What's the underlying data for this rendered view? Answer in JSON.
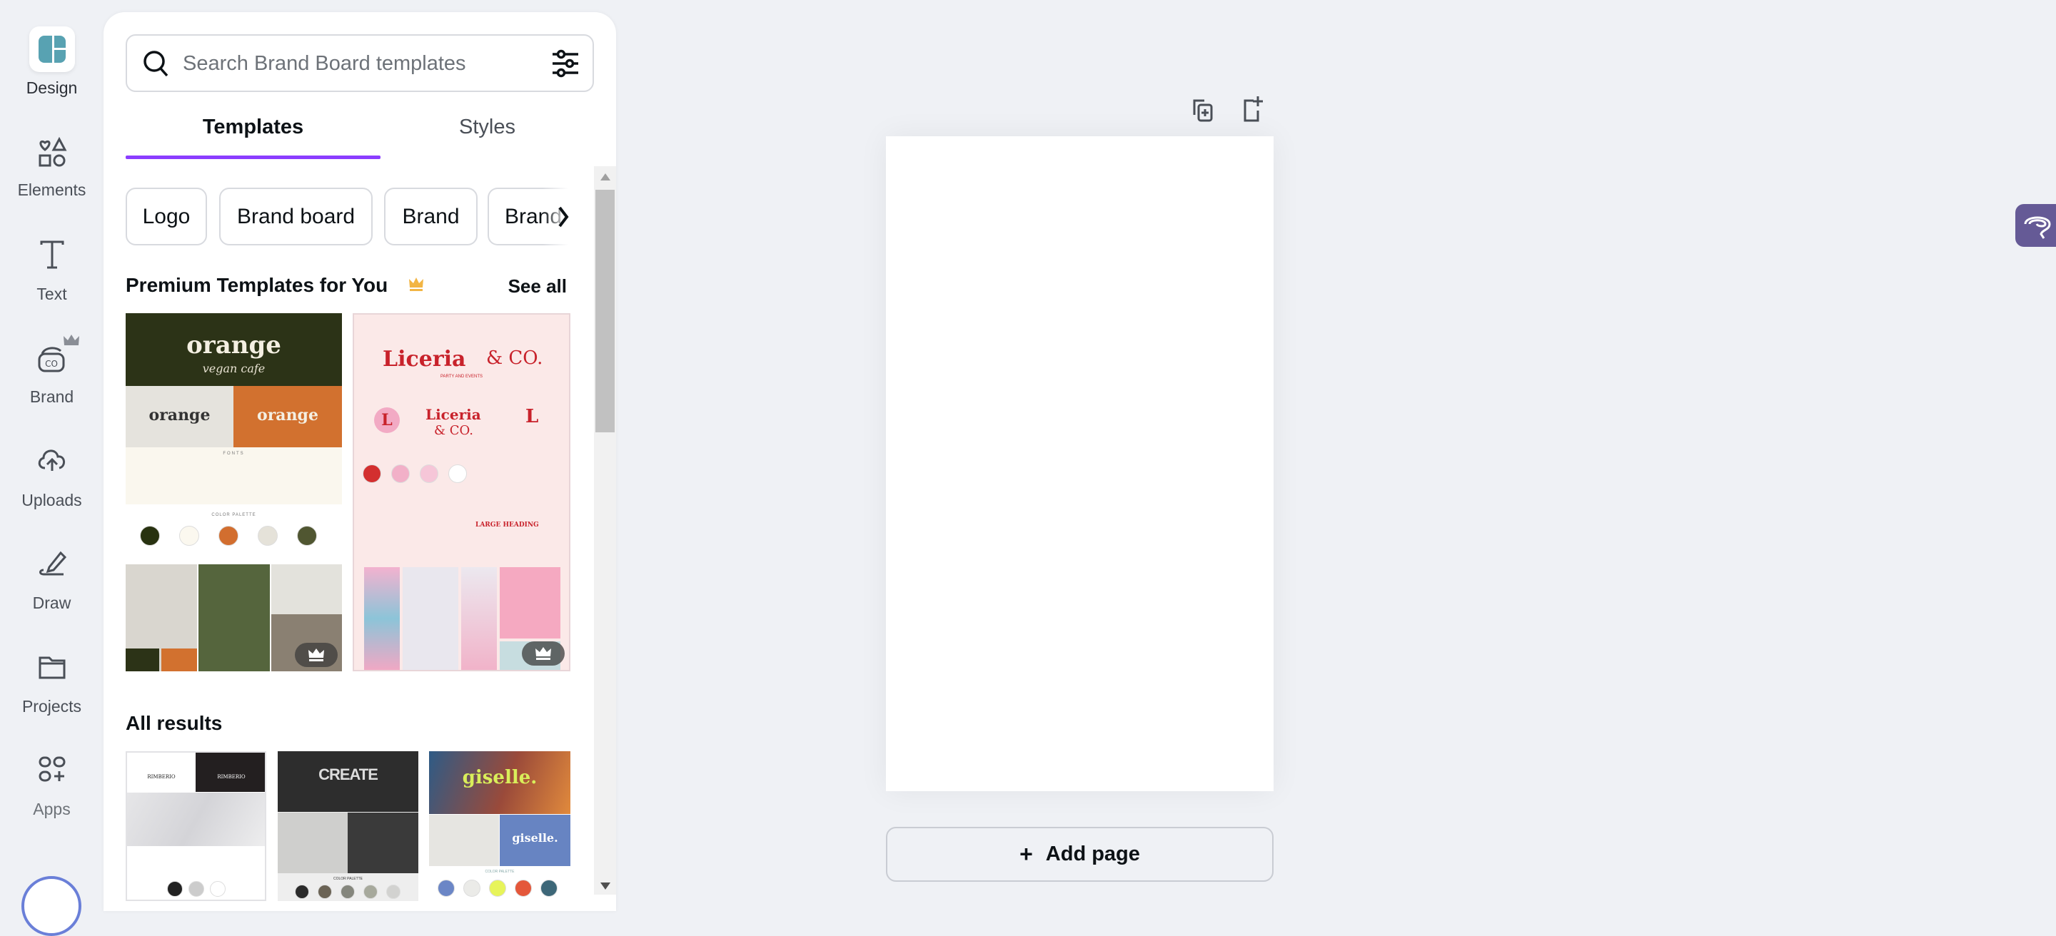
{
  "sidebar": {
    "items": [
      {
        "label": "Design",
        "icon": "design-icon"
      },
      {
        "label": "Elements",
        "icon": "elements-icon"
      },
      {
        "label": "Text",
        "icon": "text-icon"
      },
      {
        "label": "Brand",
        "icon": "brand-icon"
      },
      {
        "label": "Uploads",
        "icon": "upload-cloud-icon"
      },
      {
        "label": "Draw",
        "icon": "draw-icon"
      },
      {
        "label": "Projects",
        "icon": "folder-icon"
      },
      {
        "label": "Apps",
        "icon": "apps-icon"
      }
    ]
  },
  "panel": {
    "search": {
      "placeholder": "Search Brand Board templates",
      "value": ""
    },
    "tabs": [
      {
        "label": "Templates",
        "active": true
      },
      {
        "label": "Styles",
        "active": false
      }
    ],
    "chips": [
      "Logo",
      "Brand board",
      "Brand",
      "Brand"
    ],
    "premium": {
      "title": "Premium Templates for You",
      "see_all": "See all",
      "templates": [
        {
          "title": "orange",
          "subtitle": "vegan cafe",
          "fonts_label": "FONTS",
          "palette_label": "COLOR PALETTE",
          "palette": [
            "#283210",
            "#FBF8EF",
            "#D26E2F",
            "#E5E2D9",
            "#505631"
          ]
        },
        {
          "title": "Liceria",
          "title2": "& CO.",
          "subtitle": "PARTY AND EVENTS",
          "heading": "LARGE HEADING",
          "palette": [
            "#d32f2f",
            "#f2b0c8",
            "#f6c6d8",
            "#ffffff"
          ]
        }
      ]
    },
    "all_results": {
      "title": "All results",
      "templates": [
        {
          "title": "RIMBERIO",
          "palette": [
            "#222222",
            "#cccccc",
            "#ffffff"
          ]
        },
        {
          "title": "CREATE",
          "palette_label": "COLOR PALETTE",
          "palette": [
            "#2b2b2b",
            "#6b6355",
            "#85867d",
            "#a7a99c",
            "#d2d2d0"
          ]
        },
        {
          "title": "giselle.",
          "palette_label": "COLOR PALETTE",
          "palette": [
            "#6b86c6",
            "#ebebe8",
            "#e7f45a",
            "#e4573a",
            "#3d6778"
          ]
        }
      ]
    }
  },
  "canvas": {
    "add_page": "Add page"
  },
  "colors": {
    "accent": "#7d2ae8",
    "tab_underline": "#8b3dff",
    "assistant_tab": "#655a96",
    "premium_crown": "#f2b544"
  }
}
